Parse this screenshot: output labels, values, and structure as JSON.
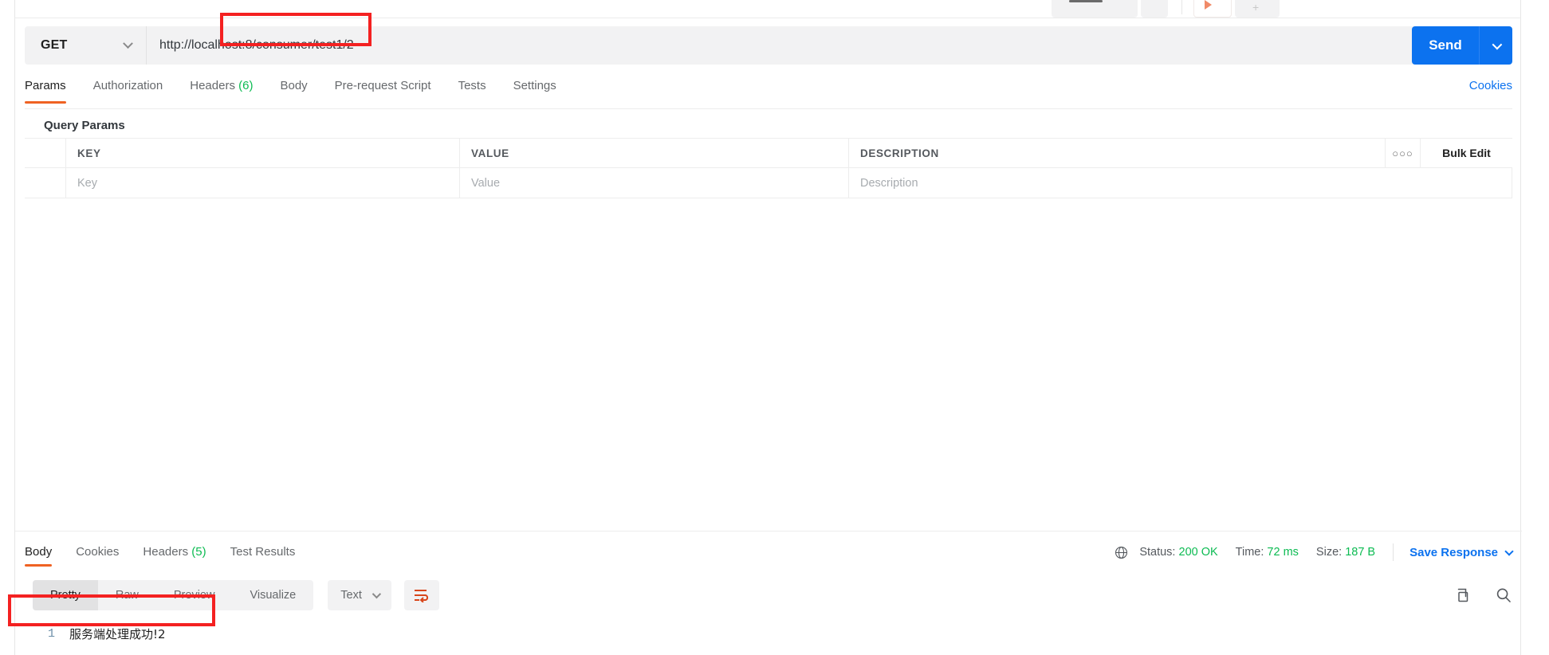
{
  "request": {
    "method": "GET",
    "url_prefix": "http://localhost:8",
    "url_highlighted": "/consumer/test1/2",
    "send_label": "Send",
    "tabs": [
      {
        "label": "Params",
        "count": "",
        "active": true
      },
      {
        "label": "Authorization",
        "count": "",
        "active": false
      },
      {
        "label": "Headers",
        "count": "(6)",
        "active": false
      },
      {
        "label": "Body",
        "count": "",
        "active": false
      },
      {
        "label": "Pre-request Script",
        "count": "",
        "active": false
      },
      {
        "label": "Tests",
        "count": "",
        "active": false
      },
      {
        "label": "Settings",
        "count": "",
        "active": false
      }
    ],
    "cookies_link": "Cookies"
  },
  "query_params": {
    "title": "Query Params",
    "columns": [
      "KEY",
      "VALUE",
      "DESCRIPTION"
    ],
    "dots_label": "○○○",
    "bulk_edit_label": "Bulk Edit",
    "empty_row": {
      "key_placeholder": "Key",
      "value_placeholder": "Value",
      "description_placeholder": "Description"
    }
  },
  "response": {
    "tabs": [
      {
        "label": "Body",
        "count": "",
        "active": true
      },
      {
        "label": "Cookies",
        "count": "",
        "active": false
      },
      {
        "label": "Headers",
        "count": "(5)",
        "active": false
      },
      {
        "label": "Test Results",
        "count": "",
        "active": false
      }
    ],
    "status": {
      "label": "Status:",
      "value": "200 OK"
    },
    "time": {
      "label": "Time:",
      "value": "72 ms"
    },
    "size": {
      "label": "Size:",
      "value": "187 B"
    },
    "save_response_label": "Save Response",
    "view_modes": [
      {
        "label": "Pretty",
        "active": true
      },
      {
        "label": "Raw",
        "active": false
      },
      {
        "label": "Preview",
        "active": false
      },
      {
        "label": "Visualize",
        "active": false
      }
    ],
    "format": "Text",
    "body_lines": [
      {
        "number": "1",
        "text": "服务端处理成功!2"
      }
    ]
  },
  "colors": {
    "accent_orange": "#ef6223",
    "link_blue": "#0c72ef",
    "success_green": "#0cbb52",
    "annotation_red": "#f42121"
  }
}
